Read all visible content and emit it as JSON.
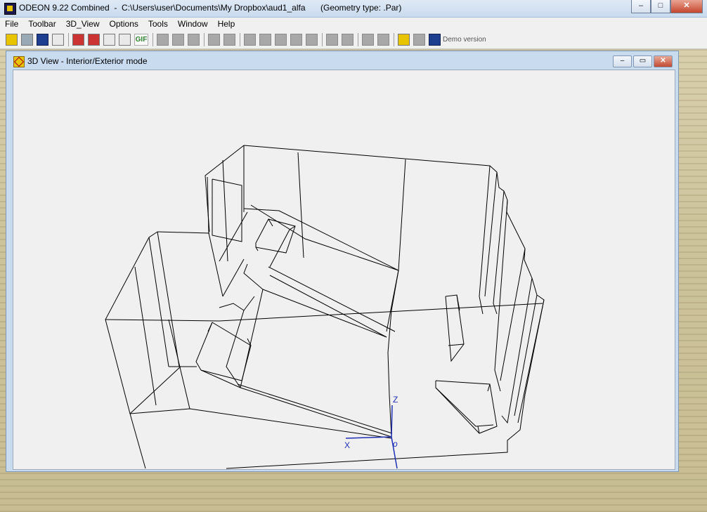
{
  "app": {
    "title": "ODEON 9.22 Combined  -  C:\\Users\\user\\Documents\\My Dropbox\\aud1_alfa",
    "geometry_type": "(Geometry type: .Par)",
    "caption_buttons": {
      "minimize": "–",
      "maximize": "□",
      "close": "✕"
    }
  },
  "menu": {
    "items": [
      "File",
      "Toolbar",
      "3D_View",
      "Options",
      "Tools",
      "Window",
      "Help"
    ]
  },
  "toolbar": {
    "gif_label": "GIF",
    "demo_label": "Demo version",
    "icons": [
      "open-folder-icon",
      "room-icon",
      "grid-icon",
      "print-icon",
      "report-icon",
      "xy-report-icon",
      "chart-icon",
      "scatter-icon",
      "gif-icon",
      "info-icon",
      "block-icon",
      "page-icon",
      "speaker-icon",
      "panel-icon",
      "wrench-icon",
      "hatch-icon",
      "mesh-icon",
      "fan-icon",
      "list-icon",
      "zigzag-icon",
      "dots-icon",
      "measure-icon",
      "square-icon",
      "3d-view-icon",
      "flag-icon",
      "cube-icon"
    ]
  },
  "child_window": {
    "title": "3D View - Interior/Exterior mode",
    "buttons": {
      "minimize": "–",
      "restore": "▭",
      "close": "✕"
    }
  },
  "view3d": {
    "axis_labels": {
      "z": "Z",
      "x": "X",
      "origin": "o"
    },
    "colors": {
      "wireframe": "#000000",
      "axes": "#1f2fb5",
      "background": "#f0f0f0"
    }
  }
}
